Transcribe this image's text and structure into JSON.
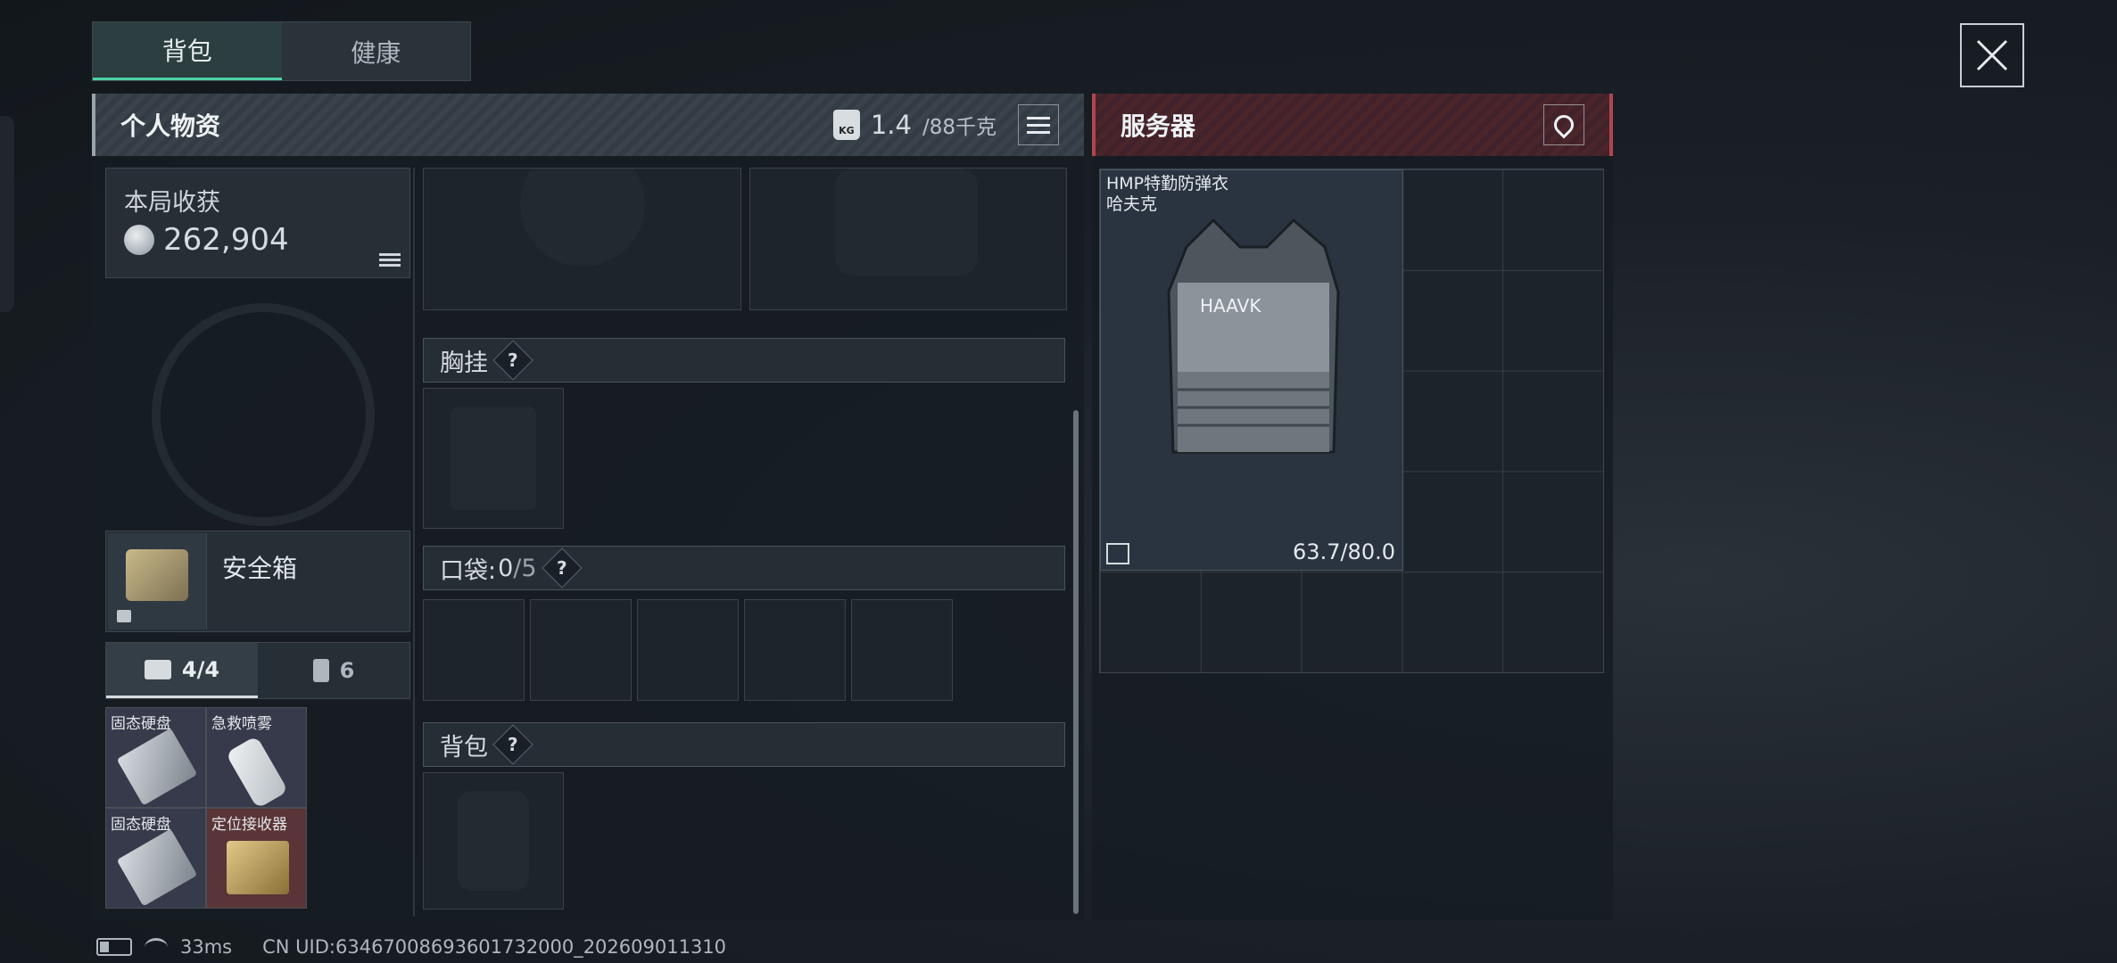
{
  "tabs": [
    {
      "label": "背包",
      "active": true
    },
    {
      "label": "健康",
      "active": false
    }
  ],
  "personal": {
    "title": "个人物资",
    "weight_current": "1.4",
    "weight_max": "/88千克",
    "kg_icon": "KG"
  },
  "harvest": {
    "label": "本局收获",
    "value": "262,904"
  },
  "safebox": {
    "label": "安全箱"
  },
  "case_tabs": [
    {
      "label": "4/4",
      "icon": "briefcase-icon",
      "active": true
    },
    {
      "label": "6",
      "icon": "canister-icon",
      "active": false
    }
  ],
  "case_items": [
    {
      "name": "固态硬盘"
    },
    {
      "name": "急救喷雾"
    },
    {
      "name": "固态硬盘"
    },
    {
      "name": "定位接收器"
    }
  ],
  "sections": {
    "chest_rig": "胸挂",
    "pockets_label": "口袋:",
    "pockets_count": "0",
    "pockets_max": "/5",
    "backpack": "背包"
  },
  "question_mark": "?",
  "server": {
    "title": "服务器"
  },
  "loot_item": {
    "name": "HMP特勤防弹衣",
    "brand": "哈夫克",
    "durability": "63.7/80.0",
    "logo_text": "HAAVK"
  },
  "status": {
    "ping": "33ms",
    "uid": "CN UID:6346700869360173200​0_202609011310"
  },
  "colors": {
    "accent": "#4fd1a5",
    "server_accent": "#b04650"
  }
}
